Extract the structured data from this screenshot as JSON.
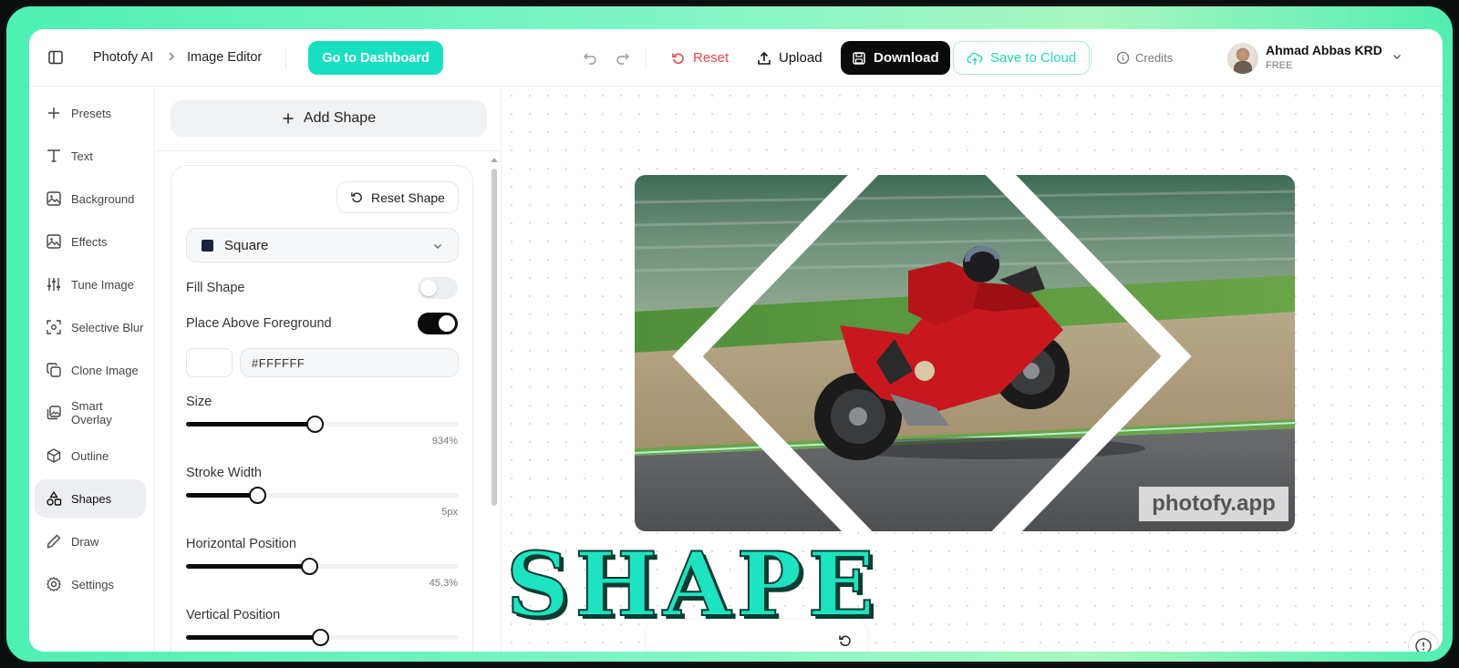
{
  "breadcrumb": {
    "app": "Photofy AI",
    "page": "Image Editor"
  },
  "toolbar": {
    "dashboard_label": "Go to Dashboard",
    "reset_label": "Reset",
    "upload_label": "Upload",
    "download_label": "Download",
    "save_cloud_label": "Save to Cloud",
    "credits_label": "Credits"
  },
  "user": {
    "name": "Ahmad Abbas KRD",
    "plan": "FREE"
  },
  "sidebar": {
    "items": [
      {
        "label": "Presets",
        "icon": "plus-icon"
      },
      {
        "label": "Text",
        "icon": "text-icon"
      },
      {
        "label": "Background",
        "icon": "image-icon"
      },
      {
        "label": "Effects",
        "icon": "image-icon"
      },
      {
        "label": "Tune Image",
        "icon": "sliders-icon"
      },
      {
        "label": "Selective Blur",
        "icon": "focus-icon"
      },
      {
        "label": "Clone Image",
        "icon": "copy-icon"
      },
      {
        "label": "Smart Overlay",
        "icon": "images-icon"
      },
      {
        "label": "Outline",
        "icon": "box-icon"
      },
      {
        "label": "Shapes",
        "icon": "shapes-icon",
        "active": true
      },
      {
        "label": "Draw",
        "icon": "pencil-icon"
      },
      {
        "label": "Settings",
        "icon": "gear-icon"
      }
    ]
  },
  "panel": {
    "add_shape_label": "Add Shape",
    "reset_shape_label": "Reset Shape",
    "shape_select": "Square",
    "fill_shape_label": "Fill Shape",
    "fill_shape_on": false,
    "place_above_label": "Place Above Foreground",
    "place_above_on": true,
    "color_hex": "#FFFFFF",
    "sliders": [
      {
        "label": "Size",
        "value": "934%",
        "level": 0.47
      },
      {
        "label": "Stroke Width",
        "value": "5px",
        "level": 0.26
      },
      {
        "label": "Horizontal Position",
        "value": "45.3%",
        "level": 0.453
      },
      {
        "label": "Vertical Position",
        "value": "",
        "level": 0.49
      }
    ]
  },
  "canvas": {
    "watermark": "photofy.app"
  },
  "overlay_title": "SHAPE",
  "colors": {
    "accent": "#18dfc0",
    "reset": "#e5484d",
    "frame": "#4ef0b3"
  }
}
